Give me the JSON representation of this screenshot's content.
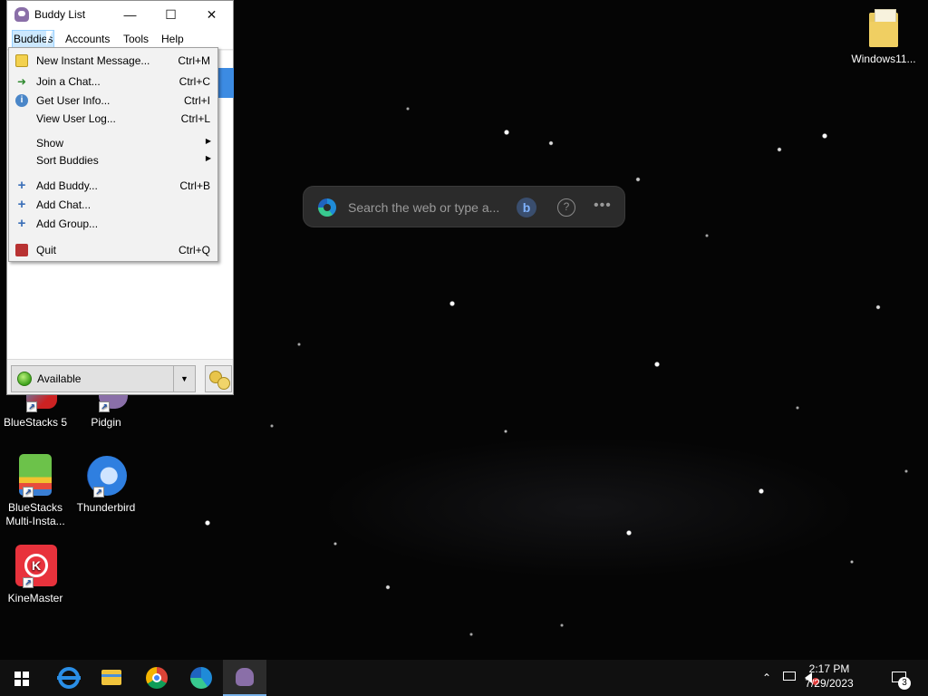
{
  "window": {
    "title": "Buddy List",
    "controls": {
      "minimize": "—",
      "maximize": "☐",
      "close": "✕"
    }
  },
  "menubar": [
    {
      "label": "Buddies"
    },
    {
      "label": "Accounts"
    },
    {
      "label": "Tools"
    },
    {
      "label": "Help"
    }
  ],
  "buddies_menu": {
    "items": [
      {
        "label": "New Instant Message...",
        "accelerator": "Ctrl+M"
      },
      {
        "label": "Join a Chat...",
        "accelerator": "Ctrl+C"
      },
      {
        "label": "Get User Info...",
        "accelerator": "Ctrl+I"
      },
      {
        "label": "View User Log...",
        "accelerator": "Ctrl+L"
      },
      {
        "label": "Show"
      },
      {
        "label": "Sort Buddies"
      },
      {
        "label": "Add Buddy...",
        "accelerator": "Ctrl+B"
      },
      {
        "label": "Add Chat..."
      },
      {
        "label": "Add Group..."
      },
      {
        "label": "Quit",
        "accelerator": "Ctrl+Q"
      }
    ]
  },
  "status": {
    "label": "Available"
  },
  "search": {
    "placeholder": "Search the web or type a..."
  },
  "desktop_icons": [
    {
      "label": "Windows11..."
    },
    {
      "label": "BlueStacks 5"
    },
    {
      "label": "Pidgin"
    },
    {
      "label": "BlueStacks Multi-Insta..."
    },
    {
      "label": "Thunderbird"
    },
    {
      "label": "KineMaster"
    }
  ],
  "taskbar": {
    "time": "2:17 PM",
    "date": "7/29/2023",
    "notification_count": "3"
  }
}
